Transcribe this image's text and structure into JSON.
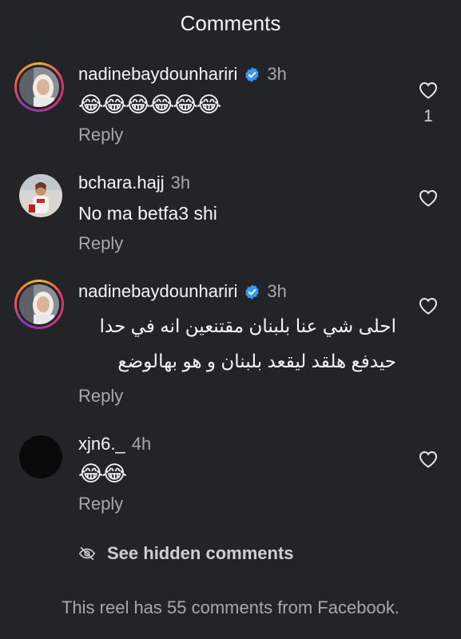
{
  "header": {
    "title": "Comments"
  },
  "comments": [
    {
      "username": "nadinebaydounhariri",
      "verified": true,
      "time": "3h",
      "text": "😂😂😂😂😂😂",
      "reply": "Reply",
      "likes": "1"
    },
    {
      "username": "bchara.hajj",
      "verified": false,
      "time": "3h",
      "text": "No ma betfa3 shi",
      "reply": "Reply",
      "likes": ""
    },
    {
      "username": "nadinebaydounhariri",
      "verified": true,
      "time": "3h",
      "text": "احلى شي عنا بلبنان مقتنعين انه في حدا حيدفع هلقد ليقعد بلبنان و هو بهالوضع",
      "reply": "Reply",
      "likes": ""
    },
    {
      "username": "xjn6._",
      "verified": false,
      "time": "4h",
      "text": "😂😂",
      "reply": "Reply",
      "likes": ""
    }
  ],
  "hidden_comments": {
    "label": "See hidden comments",
    "icon": "eye-off-icon"
  },
  "footer": {
    "text": "This reel has 55 comments from Facebook."
  },
  "colors": {
    "background": "#232427",
    "secondary_text": "#a8a8a8",
    "verified_blue": "#3897f0"
  }
}
